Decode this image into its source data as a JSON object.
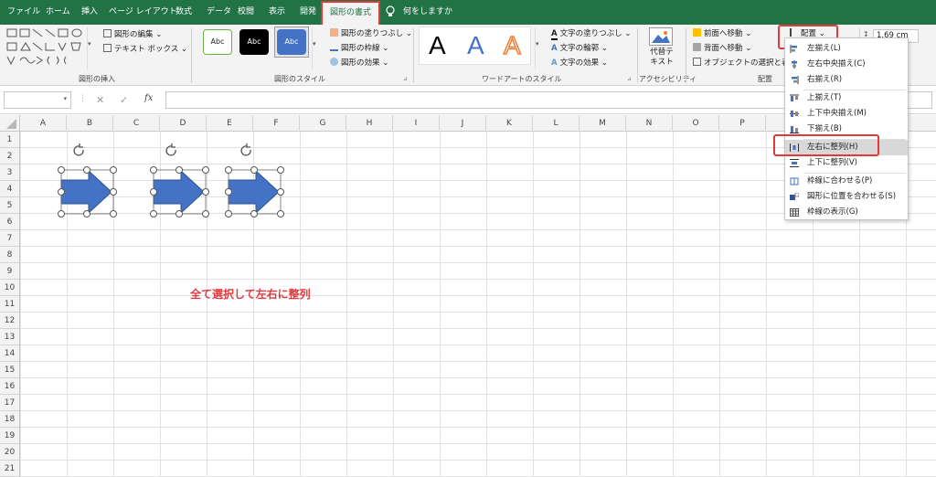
{
  "tabs": [
    {
      "label": "ファイル"
    },
    {
      "label": "ホーム"
    },
    {
      "label": "挿入"
    },
    {
      "label": "ページ レイアウト"
    },
    {
      "label": "数式"
    },
    {
      "label": "データ"
    },
    {
      "label": "校閲"
    },
    {
      "label": "表示"
    },
    {
      "label": "開発"
    },
    {
      "label": "図形の書式"
    },
    {
      "label": "何をしますか"
    }
  ],
  "ribbon": {
    "insert_shapes": {
      "edit_shape": "図形の編集",
      "text_box": "テキスト ボックス",
      "label": "図形の挿入"
    },
    "shape_styles": {
      "presets": [
        "Abc",
        "Abc",
        "Abc"
      ],
      "fill": "図形の塗りつぶし",
      "outline": "図形の枠線",
      "effects": "図形の効果",
      "label": "図形のスタイル"
    },
    "wordart": {
      "letters": [
        "A",
        "A",
        "A"
      ],
      "text_fill": "文字の塗りつぶし",
      "text_outline": "文字の輪郭",
      "text_effects": "文字の効果",
      "label": "ワードアートのスタイル"
    },
    "accessibility": {
      "alt_text_line1": "代替テ",
      "alt_text_line2": "キスト",
      "label": "アクセシビリティ"
    },
    "arrange": {
      "bring_forward": "前面へ移動",
      "send_backward": "背面へ移動",
      "selection_pane": "オブジェクトの選択と表示",
      "align_button": "配置",
      "label": "配置"
    },
    "size": {
      "height": "1.69 cm"
    }
  },
  "formula_bar": {
    "fx": "fx",
    "cancel": "✕",
    "enter": "✓"
  },
  "columns": [
    "A",
    "B",
    "C",
    "D",
    "E",
    "F",
    "G",
    "H",
    "I",
    "J",
    "K",
    "L",
    "M",
    "N",
    "O",
    "P"
  ],
  "rows": [
    "1",
    "2",
    "3",
    "4",
    "5",
    "6",
    "7",
    "8",
    "9",
    "10",
    "11",
    "12",
    "13",
    "14",
    "15",
    "16",
    "17",
    "18",
    "19",
    "20",
    "21"
  ],
  "annotation": "全て選択して左右に整列",
  "align_menu": {
    "items": [
      {
        "label": "左揃え(L)",
        "icon": "align-left-icon"
      },
      {
        "label": "左右中央揃え(C)",
        "icon": "align-center-icon"
      },
      {
        "label": "右揃え(R)",
        "icon": "align-right-icon"
      },
      {
        "label": "上揃え(T)",
        "icon": "align-top-icon"
      },
      {
        "label": "上下中央揃え(M)",
        "icon": "align-middle-icon"
      },
      {
        "label": "下揃え(B)",
        "icon": "align-bottom-icon"
      },
      {
        "label": "左右に整列(H)",
        "icon": "distribute-horizontal-icon"
      },
      {
        "label": "上下に整列(V)",
        "icon": "distribute-vertical-icon"
      },
      {
        "label": "枠線に合わせる(P)",
        "icon": "snap-to-grid-icon"
      },
      {
        "label": "図形に位置を合わせる(S)",
        "icon": "snap-to-shape-icon"
      },
      {
        "label": "枠線の表示(G)",
        "icon": "view-gridlines-icon"
      }
    ]
  },
  "colors": {
    "ribbon_green": "#217346",
    "shape_blue": "#4472c4",
    "highlight_red": "#e0393e"
  }
}
